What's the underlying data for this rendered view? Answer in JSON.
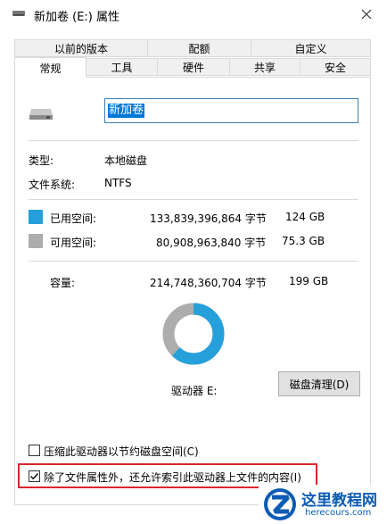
{
  "window": {
    "title": "新加卷 (E:) 属性"
  },
  "tabs_row1": [
    {
      "label": "以前的版本"
    },
    {
      "label": "配额"
    },
    {
      "label": "自定义"
    }
  ],
  "tabs_row2": [
    {
      "label": "常规"
    },
    {
      "label": "工具"
    },
    {
      "label": "硬件"
    },
    {
      "label": "共享"
    },
    {
      "label": "安全"
    }
  ],
  "volume": {
    "name": "新加卷"
  },
  "info": {
    "type_label": "类型:",
    "type_value": "本地磁盘",
    "fs_label": "文件系统:",
    "fs_value": "NTFS"
  },
  "usage": {
    "used_label": "已用空间:",
    "used_bytes": "133,839,396,864 字节",
    "used_gb": "124 GB",
    "used_color": "#26a0da",
    "free_label": "可用空间:",
    "free_bytes": "80,908,963,840 字节",
    "free_gb": "75.3 GB",
    "free_color": "#adadad",
    "capacity_label": "容量:",
    "capacity_bytes": "214,748,360,704 字节",
    "capacity_gb": "199 GB",
    "used_fraction": 0.623
  },
  "drive_label": "驱动器 E:",
  "cleanup_button": "磁盘清理(D)",
  "options": {
    "compress_label": "压缩此驱动器以节约磁盘空间(C)",
    "compress_checked": false,
    "index_label": "除了文件属性外，还允许索引此驱动器上文件的内容(I)",
    "index_checked": true
  },
  "watermark": {
    "title": "这里教程网",
    "url": "herecours.com"
  }
}
